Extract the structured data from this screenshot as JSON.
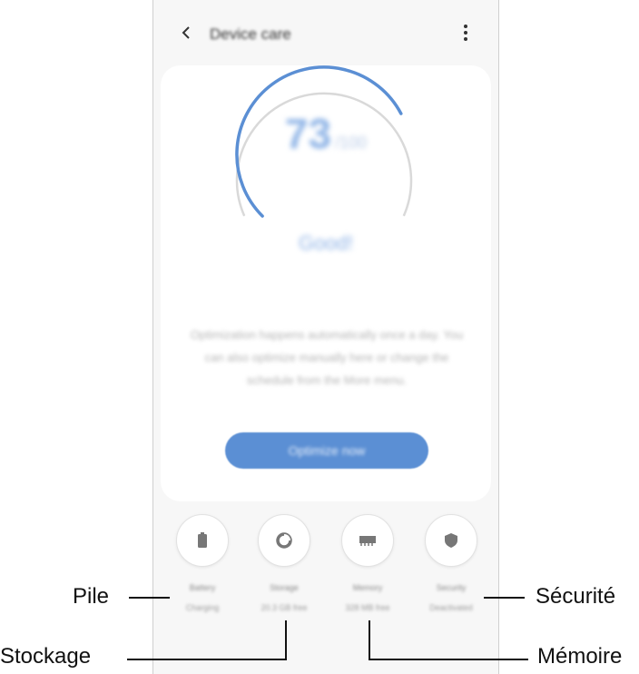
{
  "app": {
    "title": "Device care"
  },
  "score": {
    "value": "73",
    "max": "/100",
    "status": "Good!",
    "gauge_fraction": 0.73
  },
  "description": "Optimization happens automatically once a day. You can also optimize manually here or change the schedule from the More menu.",
  "optimize_button": "Optimize now",
  "tiles": [
    {
      "label": "Battery",
      "sub": "Charging"
    },
    {
      "label": "Storage",
      "sub": "20.3 GB free"
    },
    {
      "label": "Memory",
      "sub": "328 MB free"
    },
    {
      "label": "Security",
      "sub": "Deactivated"
    }
  ],
  "callouts": {
    "battery": "Pile",
    "storage": "Stockage",
    "memory": "Mémoire",
    "security": "Sécurité"
  },
  "icons": {
    "back": "chevron-left-icon",
    "more": "more-vertical-icon",
    "battery": "battery-icon",
    "storage": "storage-pie-icon",
    "memory": "memory-chip-icon",
    "security": "shield-icon"
  },
  "colors": {
    "accent": "#5b8fd4",
    "gauge_track": "#d9d9d9"
  }
}
